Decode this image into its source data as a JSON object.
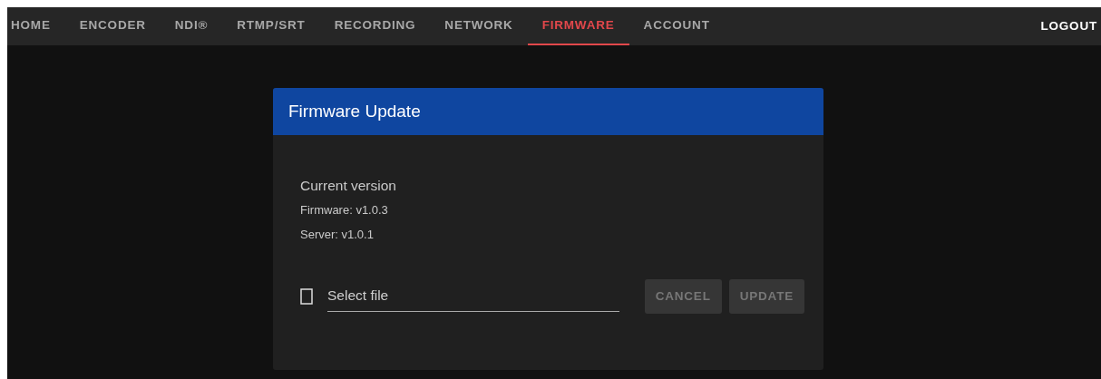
{
  "nav": {
    "tabs": [
      {
        "label": "HOME",
        "selected": false
      },
      {
        "label": "ENCODER",
        "selected": false
      },
      {
        "label": "NDI®",
        "selected": false
      },
      {
        "label": "RTMP/SRT",
        "selected": false
      },
      {
        "label": "RECORDING",
        "selected": false
      },
      {
        "label": "NETWORK",
        "selected": false
      },
      {
        "label": "FIRMWARE",
        "selected": true
      },
      {
        "label": "ACCOUNT",
        "selected": false
      }
    ],
    "logout": "LOGOUT"
  },
  "dialog": {
    "title": "Firmware Update",
    "heading": "Current version",
    "versions": [
      "Firmware: v1.0.3",
      "Server: v1.0.1"
    ],
    "file_field": {
      "placeholder": "Select file"
    },
    "buttons": [
      {
        "label": "CANCEL",
        "disabled": true
      },
      {
        "label": "UPDATE",
        "disabled": true
      }
    ]
  }
}
